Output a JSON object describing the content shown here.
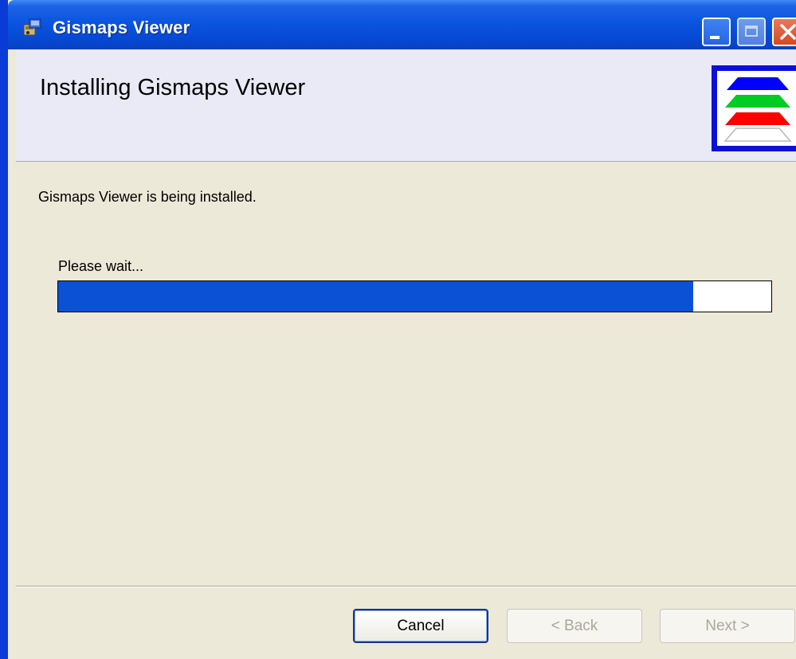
{
  "window": {
    "title": "Gismaps Viewer",
    "icon": "installer-package-icon",
    "controls": {
      "minimize": "minimize-icon",
      "maximize": "maximize-icon",
      "close": "close-icon"
    }
  },
  "banner": {
    "title": "Installing Gismaps Viewer",
    "logo": "layers-logo-icon",
    "logo_colors": [
      "#0000ff",
      "#00cc22",
      "#ff0000",
      "#ffffff"
    ]
  },
  "body": {
    "status": "Gismaps Viewer is being installed.",
    "wait_label": "Please wait...",
    "progress_percent": 89,
    "progress_color": "#0a51d6"
  },
  "buttons": {
    "cancel": "Cancel",
    "back": "< Back",
    "next": "Next >"
  }
}
